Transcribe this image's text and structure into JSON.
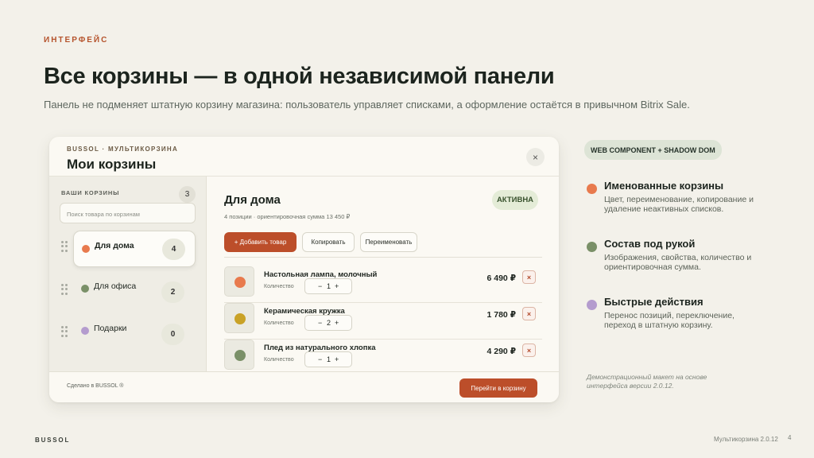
{
  "eyebrow": "ИНТЕРФЕЙС",
  "headline": "Все корзины — в одной независимой панели",
  "lead": "Панель не подменяет штатную корзину магазина: пользователь управляет списками, а оформление остаётся в привычном Bitrix Sale.",
  "panel": {
    "brand": "BUSSOL · МУЛЬТИКОРЗИНА",
    "title": "Мои корзины",
    "close_label": "×",
    "sidebar": {
      "label": "ВАШИ КОРЗИНЫ",
      "count": "3",
      "search_placeholder": "Поиск товара по корзинам",
      "carts": [
        {
          "name": "Для дома",
          "count": "4",
          "color": "#e87a4d",
          "active": true
        },
        {
          "name": "Для офиса",
          "count": "2",
          "color": "#7a9068",
          "active": false
        },
        {
          "name": "Подарки",
          "count": "0",
          "color": "#b49cce",
          "active": false
        }
      ]
    },
    "main": {
      "title": "Для дома",
      "meta": "4 позиции · ориентировочная сумма 13 450 ₽",
      "status": "АКТИВНА",
      "add_button": "+ Добавить товар",
      "copy_button": "Копировать",
      "rename_button": "Переименовать",
      "products": [
        {
          "name": "Настольная лампа, молочный",
          "qty_label": "Количество",
          "minus": "−",
          "qty": "1",
          "plus": "+",
          "price": "6 490 ₽",
          "remove": "×",
          "color": "#e87a4d"
        },
        {
          "name": "Керамическая кружка",
          "qty_label": "Количество",
          "minus": "−",
          "qty": "2",
          "plus": "+",
          "price": "1 780 ₽",
          "remove": "×",
          "color": "#c9a227"
        },
        {
          "name": "Плед из натурального хлопка",
          "qty_label": "Количество",
          "minus": "−",
          "qty": "1",
          "plus": "+",
          "price": "4 290 ₽",
          "remove": "×",
          "color": "#7a9068"
        }
      ]
    },
    "footer_note": "Сделано в BUSSOL ®",
    "checkout_button": "Перейти в корзину"
  },
  "tech_badge": "WEB COMPONENT + SHADOW DOM",
  "features": [
    {
      "title": "Именованные корзины",
      "desc": "Цвет, переименование, копирование и удаление неактивных списков.",
      "color": "#e87a4d"
    },
    {
      "title": "Состав под рукой",
      "desc": "Изображения, свойства, количество и ориентировочная сумма.",
      "color": "#7a9068"
    },
    {
      "title": "Быстрые действия",
      "desc": "Перенос позиций, переключение, переход в штатную корзину.",
      "color": "#b49cce"
    }
  ],
  "demo_note": "Демонстрационный макет на основе интерфейса версии 2.0.12.",
  "footer": {
    "brand": "BUSSOL",
    "product": "Мультикорзина 2.0.12",
    "page": "4"
  }
}
